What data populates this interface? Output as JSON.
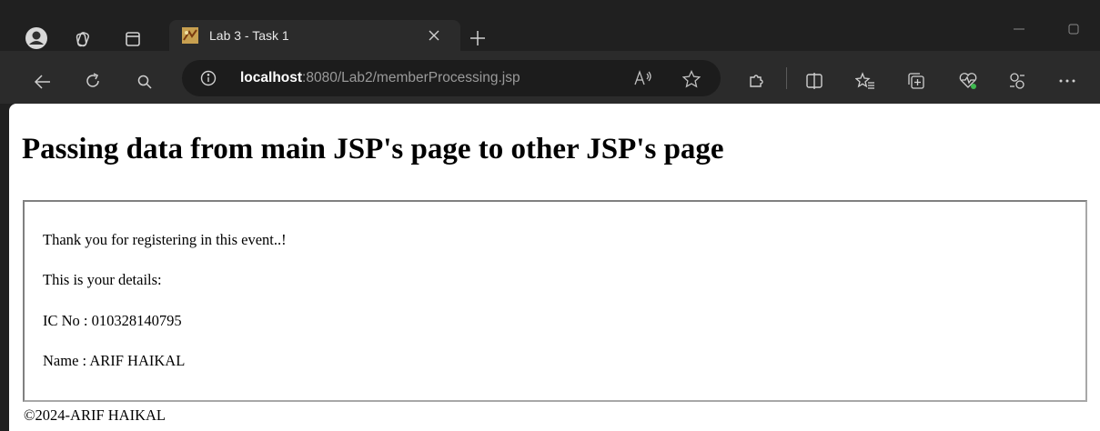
{
  "browser": {
    "tab": {
      "title": "Lab 3 - Task 1"
    },
    "new_tab_symbol": "+",
    "address": {
      "host": "localhost",
      "path": ":8080/Lab2/memberProcessing.jsp"
    },
    "icons": [
      "profile-icon",
      "workspaces-icon",
      "tab-actions-icon",
      "close-tab-icon",
      "new-tab-icon",
      "minimize-icon",
      "maximize-icon",
      "back-icon",
      "refresh-icon",
      "search-icon",
      "info-icon",
      "read-aloud-icon",
      "favorite-star-icon",
      "extensions-icon",
      "split-screen-icon",
      "favorites-icon",
      "collections-icon",
      "browser-essentials-icon",
      "copilot-icon",
      "more-icon"
    ]
  },
  "page": {
    "heading": "Passing data from main JSP's page to other JSP's page",
    "lines": [
      "Thank you for registering in this event..!",
      "This is your details:",
      "IC No : 010328140795",
      "Name : ARIF HAIKAL"
    ],
    "footer": "©2024-ARIF HAIKAL"
  }
}
